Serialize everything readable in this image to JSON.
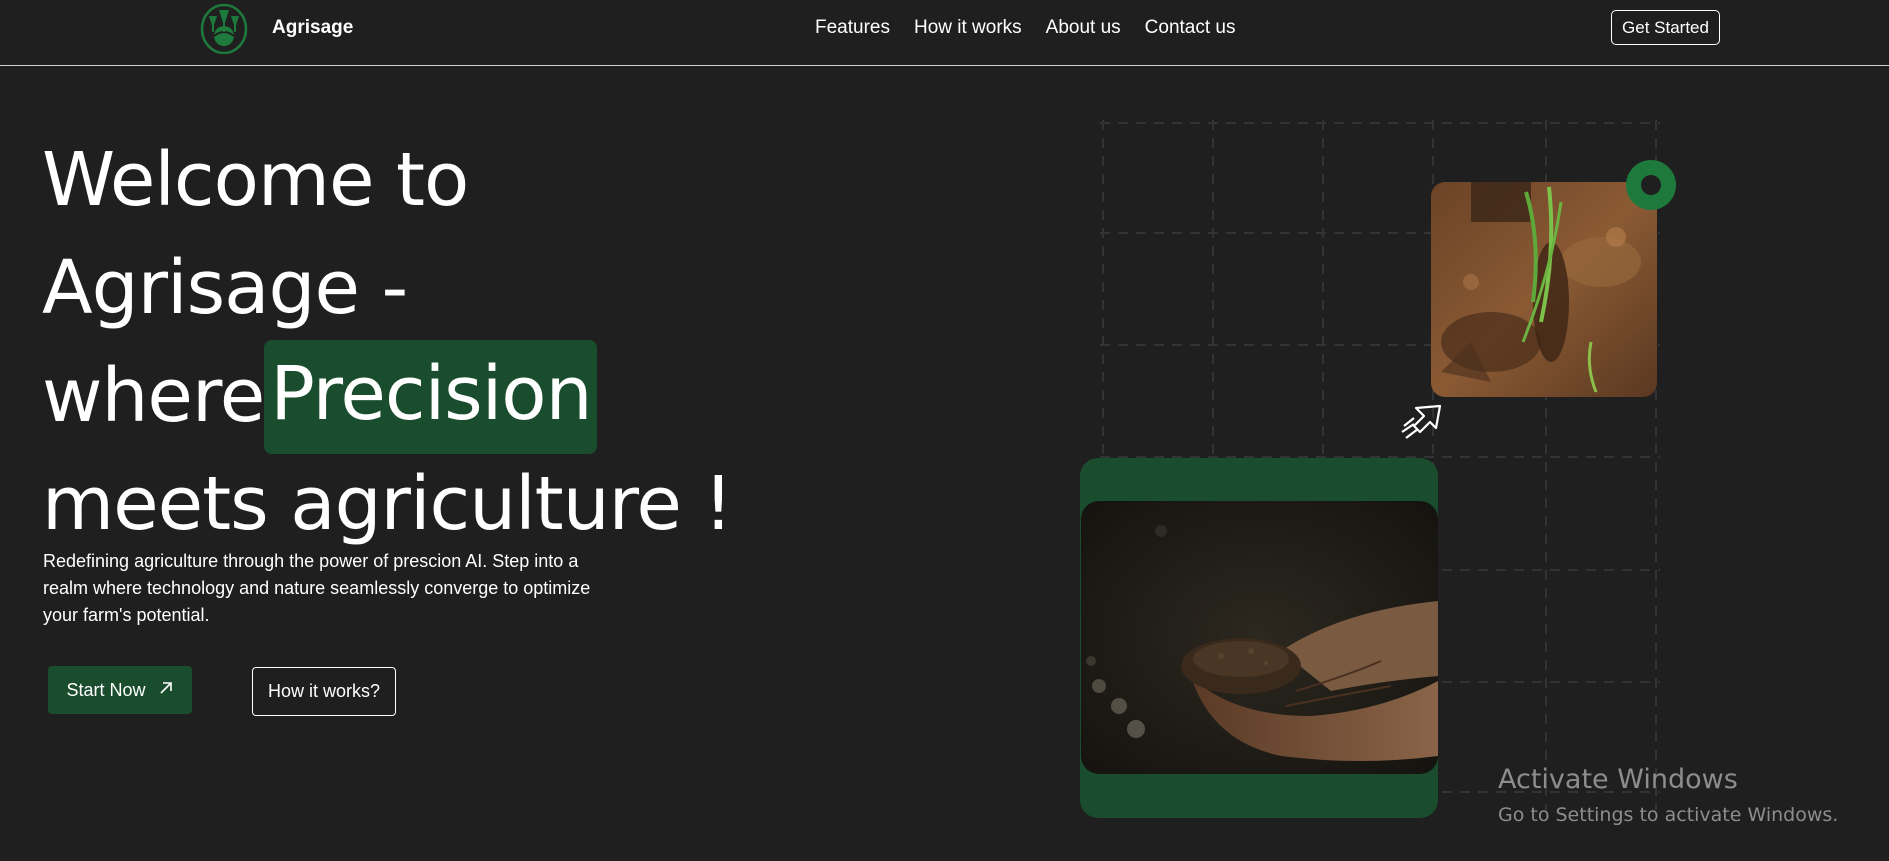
{
  "nav": {
    "brand": "Agrisage",
    "links": [
      {
        "label": "Features"
      },
      {
        "label": "How it works"
      },
      {
        "label": "About us"
      },
      {
        "label": "Contact us"
      }
    ],
    "cta": "Get Started"
  },
  "hero": {
    "title_line1": "Welcome to",
    "title_line2": "Agrisage -",
    "title_line3_pre": "where",
    "title_highlight": "Precision",
    "title_line4": "meets agriculture !",
    "description": "Redefining agriculture through the power of prescion AI. Step into a realm where technology and nature seamlessly converge to optimize your farm's potential.",
    "primary_button": "Start Now",
    "secondary_button": "How it works?"
  },
  "watermark": {
    "title": "Activate Windows",
    "subtitle": "Go to Settings to activate Windows."
  },
  "colors": {
    "background": "#1f1f1f",
    "accent_green": "#1a4d2e",
    "ring_green": "#1e7a3c",
    "text": "#ffffff"
  },
  "icons": {
    "logo": "plant-sprouts-logo",
    "primary_button_icon": "arrow-up-right-icon",
    "pointer": "hand-pointer-icon"
  }
}
